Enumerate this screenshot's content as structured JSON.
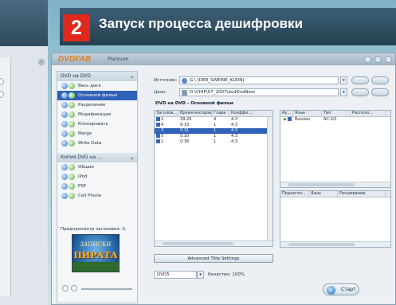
{
  "step": {
    "number": "2",
    "title": "Запуск процесса дешифровки"
  },
  "app": {
    "logo": "DVDFAB",
    "edition": "Platinum"
  },
  "sidebar": {
    "dvd_panel": {
      "title": "DVD на DVD",
      "items": [
        {
          "label": "Весь диск",
          "selected": false
        },
        {
          "label": "Основной фильм",
          "selected": true
        },
        {
          "label": "Разделение",
          "selected": false
        },
        {
          "label": "Модификация",
          "selected": false
        },
        {
          "label": "Клонировать",
          "selected": false
        },
        {
          "label": "Merge",
          "selected": false
        },
        {
          "label": "Write Data",
          "selected": false
        }
      ]
    },
    "mobile_panel": {
      "title": "Копия DVD на ...",
      "items": [
        {
          "label": "Общие"
        },
        {
          "label": "iPod"
        },
        {
          "label": "PSP"
        },
        {
          "label": "Cell Phone"
        }
      ]
    },
    "preview": {
      "label": "Предпросмотр заголовка: 3,",
      "image_text_top": "ЗАПИСКИ",
      "image_text_main": "ПИРАТА"
    }
  },
  "source": {
    "label": "Источник:",
    "value": "G:\\ [DER_SWEINE_KLEIN]"
  },
  "target": {
    "label": "Цель:",
    "value": "D:\\CHIP\\07_2007\\dvdDvdNext"
  },
  "section_title": "DVD на DVD - Основной фильм",
  "titles_table": {
    "headers": [
      "Заголов...",
      "Время воспрои...",
      "Глава",
      "Коэффи..."
    ],
    "rows": [
      {
        "cells": [
          "2",
          "39:26",
          "4",
          "4:3"
        ],
        "selected": false
      },
      {
        "cells": [
          "4",
          "9:33",
          "1",
          "4:3"
        ],
        "selected": false
      },
      {
        "cells": [
          "3",
          "0:31",
          "1",
          "4:3"
        ],
        "selected": true
      },
      {
        "cells": [
          "5",
          "5:10",
          "1",
          "4:3"
        ],
        "selected": false
      },
      {
        "cells": [
          "1",
          "0:36",
          "1",
          "4:3"
        ],
        "selected": false
      }
    ]
  },
  "audio_table": {
    "headers": [
      "Ау...",
      "Язык",
      "Тип",
      "Располо..."
    ],
    "rows": [
      {
        "cells": [
          "",
          "Russian",
          "AC-3/2",
          ""
        ]
      }
    ]
  },
  "subtitle_table": {
    "headers": [
      "Подзагол...",
      "Язык",
      "Расширение"
    ]
  },
  "buttons": {
    "advanced": "Advanced Title Settings",
    "start": "Старт"
  },
  "output": {
    "format": "DVD5",
    "quality_label": "Качество: 100%"
  }
}
